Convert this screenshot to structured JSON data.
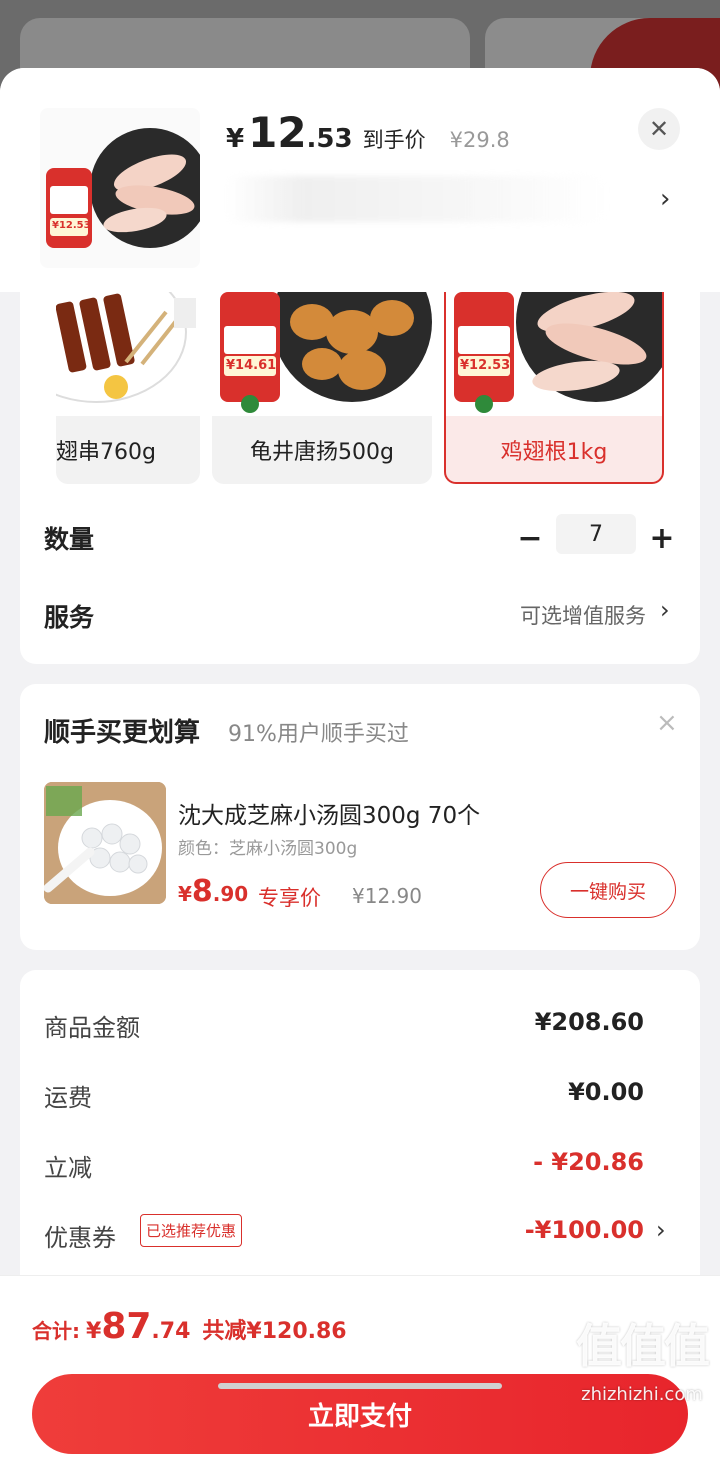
{
  "header": {
    "currency": "¥",
    "price_int": "12",
    "price_dec": ".53",
    "price_tag": "到手价",
    "original_price": "¥29.8",
    "close_icon": "close-icon",
    "more_icon": "chevron-right-icon"
  },
  "variants": [
    {
      "label": "翅串760g",
      "selected": false
    },
    {
      "label": "龟井唐扬500g",
      "selected": false,
      "promo_price": "¥14.61"
    },
    {
      "label": "鸡翅根1kg",
      "selected": true,
      "promo_price": "¥12.53"
    }
  ],
  "thumb_promo_price": "¥12.53",
  "quantity": {
    "label": "数量",
    "value": "7",
    "minus": "−",
    "plus": "+"
  },
  "service": {
    "label": "服务",
    "value": "可选增值服务",
    "chevron": "›"
  },
  "addon": {
    "title": "顺手买更划算",
    "subtitle": "91%用户顺手买过",
    "close": "×",
    "product_name": "沈大成芝麻小汤圆300g 70个",
    "attr": "颜色：芝麻小汤圆300g",
    "currency": "¥",
    "price_int": "8",
    "price_dec": ".90",
    "price_tag": "专享价",
    "original_price": "¥12.90",
    "button": "一键购买"
  },
  "summary": {
    "goods_label": "商品金额",
    "goods_value": "¥208.60",
    "shipping_label": "运费",
    "shipping_value": "¥0.00",
    "discount_label": "立减",
    "discount_value": "- ¥20.86",
    "coupon_label": "优惠券",
    "coupon_tag": "已选推荐优惠",
    "coupon_value": "-¥100.00",
    "coupon_chevron": "›"
  },
  "footer": {
    "total_label": "合计:",
    "currency": "¥",
    "total_int": "87",
    "total_dec": ".74",
    "saved": "共减¥120.86",
    "pay_button": "立即支付"
  },
  "watermark": {
    "big": "值值值",
    "small": "zhizhizhi.com"
  },
  "colors": {
    "accent": "#d9302c",
    "selected_bg": "#fbe9e8",
    "pay_button": "#e8252c"
  }
}
